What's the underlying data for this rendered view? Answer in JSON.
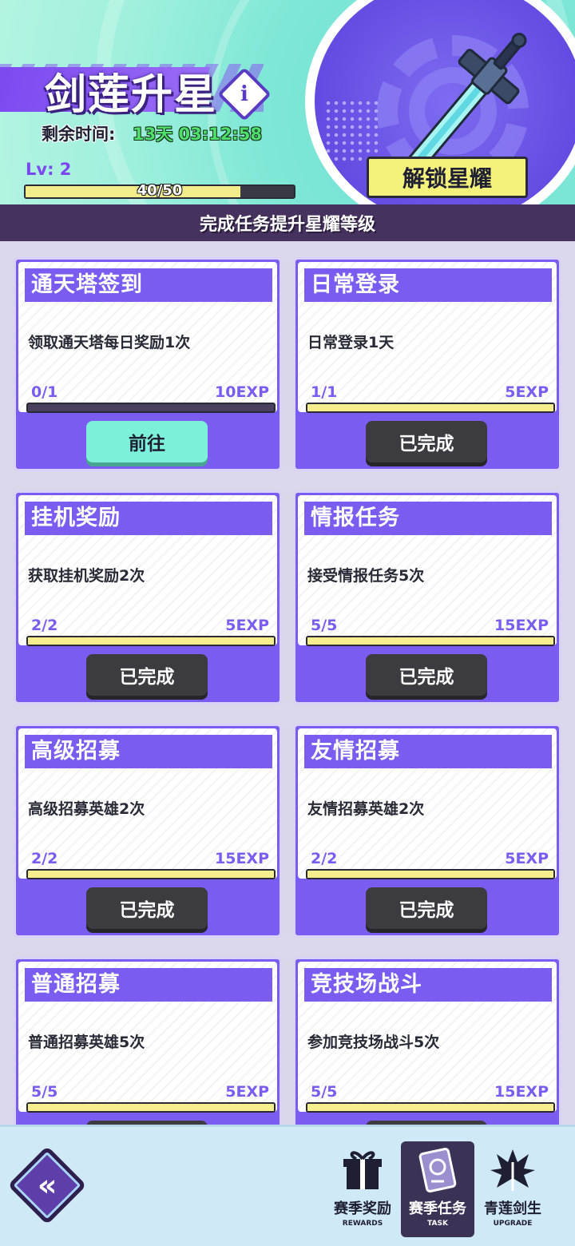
{
  "header": {
    "title": "剑莲升星",
    "info_icon": "info-icon",
    "time_label": "剩余时间:",
    "time_value": "13天 03:12:58",
    "level_text": "Lv:  2",
    "exp_text": "40/50",
    "exp_progress": 0.8,
    "unlock_label": "解锁星耀",
    "emblem_icon": "sword-icon"
  },
  "banner": "完成任务提升星耀等级",
  "tasks": [
    {
      "title": "通天塔签到",
      "desc": "领取通天塔每日奖励1次",
      "progress": "0/1",
      "exp": "10EXP",
      "fill": 0,
      "button": "前往",
      "state": "go"
    },
    {
      "title": "日常登录",
      "desc": "日常登录1天",
      "progress": "1/1",
      "exp": "5EXP",
      "fill": 1,
      "button": "已完成",
      "state": "done"
    },
    {
      "title": "挂机奖励",
      "desc": "获取挂机奖励2次",
      "progress": "2/2",
      "exp": "5EXP",
      "fill": 1,
      "button": "已完成",
      "state": "done"
    },
    {
      "title": "情报任务",
      "desc": "接受情报任务5次",
      "progress": "5/5",
      "exp": "15EXP",
      "fill": 1,
      "button": "已完成",
      "state": "done"
    },
    {
      "title": "高级招募",
      "desc": "高级招募英雄2次",
      "progress": "2/2",
      "exp": "15EXP",
      "fill": 1,
      "button": "已完成",
      "state": "done"
    },
    {
      "title": "友情招募",
      "desc": "友情招募英雄2次",
      "progress": "2/2",
      "exp": "5EXP",
      "fill": 1,
      "button": "已完成",
      "state": "done"
    },
    {
      "title": "普通招募",
      "desc": "普通招募英雄5次",
      "progress": "5/5",
      "exp": "5EXP",
      "fill": 1,
      "button": "",
      "state": "done"
    },
    {
      "title": "竞技场战斗",
      "desc": "参加竞技场战斗5次",
      "progress": "5/5",
      "exp": "15EXP",
      "fill": 1,
      "button": "",
      "state": "done"
    }
  ],
  "footer": {
    "back_icon": "double-chevron-left-icon",
    "back_label": "«",
    "nav": [
      {
        "label": "赛季奖励",
        "sub": "REWARDS",
        "icon": "gift-icon",
        "active": false
      },
      {
        "label": "赛季任务",
        "sub": "TASK",
        "icon": "task-icon",
        "active": true
      },
      {
        "label": "青莲剑生",
        "sub": "UPGRADE",
        "icon": "lotus-icon",
        "active": false
      }
    ]
  },
  "colors": {
    "accent_purple": "#7b5cf0",
    "progress_yellow": "#f6ee8c",
    "go_button": "#7cf0d8",
    "done_button": "#3c3c40",
    "time_green": "#4ee06a"
  }
}
